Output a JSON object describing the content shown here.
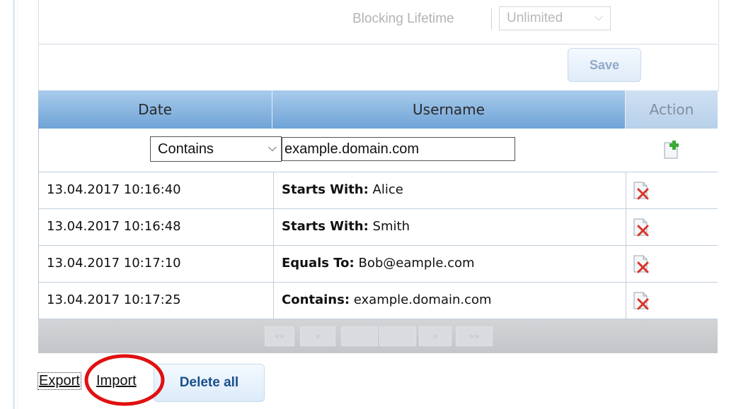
{
  "settings": {
    "lifetime_label": "Blocking Lifetime",
    "lifetime_value": "Unlimited",
    "save_label": "Save"
  },
  "table": {
    "columns": [
      "Date",
      "Username",
      "Action"
    ],
    "filter": {
      "operator": "Contains",
      "value": "example.domain.com"
    },
    "rows": [
      {
        "date": "13.04.2017 10:16:40",
        "rule": "Starts With:",
        "value": " Alice"
      },
      {
        "date": "13.04.2017 10:16:48",
        "rule": "Starts With:",
        "value": " Smith"
      },
      {
        "date": "13.04.2017 10:17:10",
        "rule": "Equals To:",
        "value": " Bob@eample.com"
      },
      {
        "date": "13.04.2017 10:17:25",
        "rule": "Contains:",
        "value": " example.domain.com"
      }
    ],
    "pager": {
      "first": "««",
      "prev": "«",
      "next": "»",
      "last": "»»"
    }
  },
  "footer": {
    "export_label": "Export",
    "import_label": "Import",
    "delete_all_label": "Delete all"
  },
  "colors": {
    "header_blue": "#6fa3d6",
    "annotation_red": "#e01010",
    "button_text": "#1a4f8a"
  },
  "icons": {
    "add": "add-document-icon",
    "delete": "delete-document-icon",
    "select_arrow": "chevron-down-icon"
  }
}
